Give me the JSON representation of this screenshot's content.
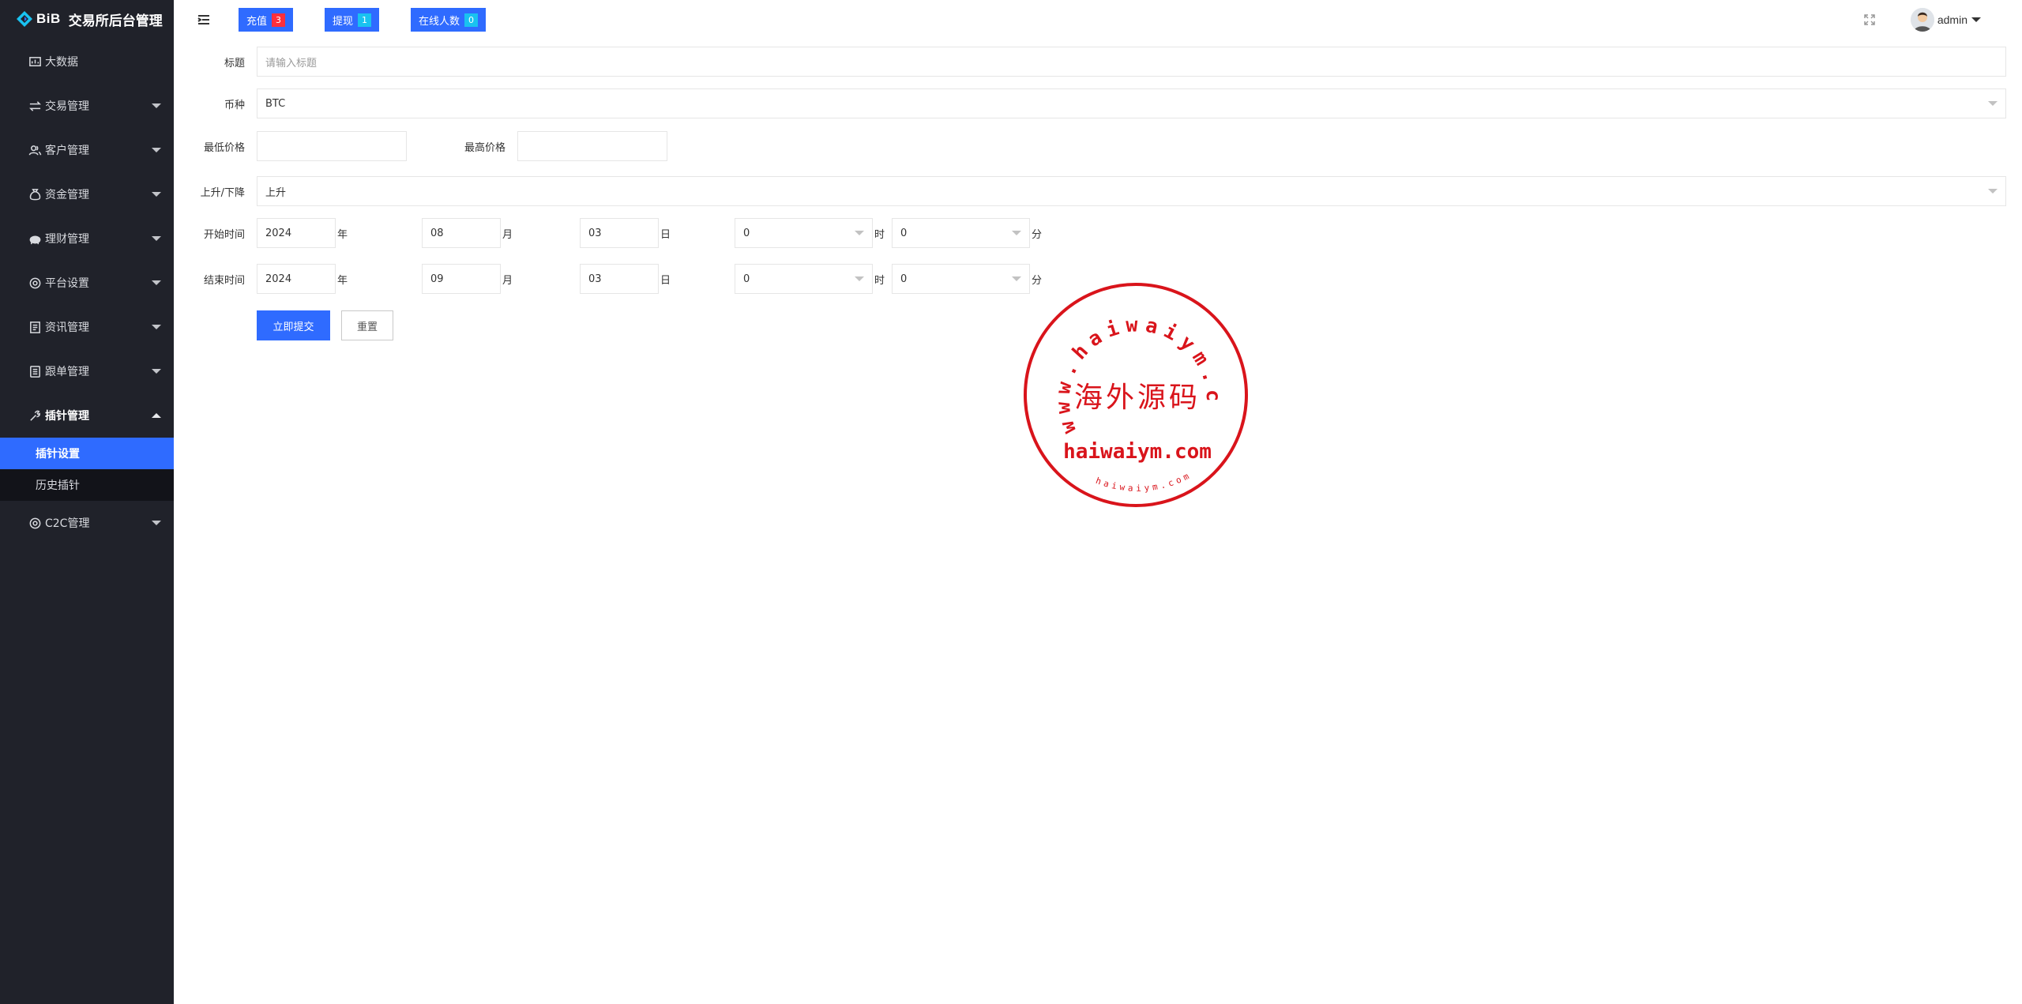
{
  "app": {
    "brand": "BiB",
    "title": "交易所后台管理"
  },
  "sidebar": {
    "items": [
      {
        "label": "大数据",
        "icon": "dashboard-icon",
        "has_children": false
      },
      {
        "label": "交易管理",
        "icon": "exchange-icon",
        "has_children": true
      },
      {
        "label": "客户管理",
        "icon": "users-icon",
        "has_children": true
      },
      {
        "label": "资金管理",
        "icon": "money-bag-icon",
        "has_children": true
      },
      {
        "label": "理财管理",
        "icon": "piggy-bank-icon",
        "has_children": true
      },
      {
        "label": "平台设置",
        "icon": "settings-icon",
        "has_children": true
      },
      {
        "label": "资讯管理",
        "icon": "news-icon",
        "has_children": true
      },
      {
        "label": "跟单管理",
        "icon": "document-icon",
        "has_children": true
      },
      {
        "label": "插针管理",
        "icon": "wrench-icon",
        "has_children": true,
        "expanded": true,
        "children": [
          {
            "label": "插针设置",
            "active": true
          },
          {
            "label": "历史插针",
            "active": false
          }
        ]
      },
      {
        "label": "C2C管理",
        "icon": "circle-icon",
        "has_children": true
      }
    ]
  },
  "header": {
    "buttons": [
      {
        "label": "充值",
        "count": "3",
        "badge_color": "#ff2f3b"
      },
      {
        "label": "提现",
        "count": "1",
        "badge_color": "#19c2f0"
      },
      {
        "label": "在线人数",
        "count": "0",
        "badge_color": "#19c2f0"
      }
    ],
    "user": "admin"
  },
  "form": {
    "title_label": "标题",
    "title_placeholder": "请输入标题",
    "coin_label": "币种",
    "coin_value": "BTC",
    "min_price_label": "最低价格",
    "max_price_label": "最高价格",
    "direction_label": "上升/下降",
    "direction_value": "上升",
    "start_label": "开始时间",
    "end_label": "结束时间",
    "units": {
      "year": "年",
      "month": "月",
      "day": "日",
      "hour": "时",
      "minute": "分"
    },
    "start": {
      "year": "2024",
      "month": "08",
      "day": "03",
      "hour": "0",
      "minute": "0"
    },
    "end": {
      "year": "2024",
      "month": "09",
      "day": "03",
      "hour": "0",
      "minute": "0"
    },
    "submit_label": "立即提交",
    "reset_label": "重置"
  },
  "watermark": {
    "ring_text": "www.haiwaiym.com",
    "center_text": "海外源码",
    "url_text": "haiwaiym.com",
    "small_text": "haiwaiym.com"
  },
  "colors": {
    "sidebar_bg": "#20222a",
    "accent": "#2f6bff",
    "stamp": "#d9141b"
  }
}
